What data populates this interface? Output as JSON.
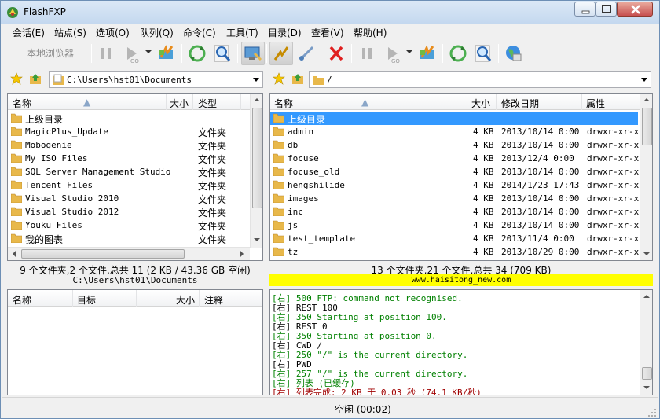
{
  "window": {
    "title": "FlashFXP"
  },
  "menu": [
    "会话(E)",
    "站点(S)",
    "选项(O)",
    "队列(Q)",
    "命令(C)",
    "工具(T)",
    "目录(D)",
    "查看(V)",
    "帮助(H)"
  ],
  "toolbar": {
    "local_browser_label": "本地浏览器"
  },
  "left": {
    "path": "C:\\Users\\hst01\\Documents",
    "columns": [
      "名称",
      "大小",
      "类型"
    ],
    "rows": [
      {
        "name": "上级目录",
        "size": "",
        "type": ""
      },
      {
        "name": "MagicPlus_Update",
        "size": "",
        "type": "文件夹"
      },
      {
        "name": "Mobogenie",
        "size": "",
        "type": "文件夹"
      },
      {
        "name": "My ISO Files",
        "size": "",
        "type": "文件夹"
      },
      {
        "name": "SQL Server Management Studio",
        "size": "",
        "type": "文件夹"
      },
      {
        "name": "Tencent Files",
        "size": "",
        "type": "文件夹"
      },
      {
        "name": "Visual Studio 2010",
        "size": "",
        "type": "文件夹"
      },
      {
        "name": "Visual Studio 2012",
        "size": "",
        "type": "文件夹"
      },
      {
        "name": "Youku Files",
        "size": "",
        "type": "文件夹"
      },
      {
        "name": "我的图表",
        "size": "",
        "type": "文件夹"
      }
    ],
    "status_summary": "9 个文件夹,2 个文件,总共 11 (2 KB / 43.36 GB 空闲)",
    "status_path": "C:\\Users\\hst01\\Documents"
  },
  "right": {
    "path": "/",
    "columns": [
      "名称",
      "大小",
      "修改日期",
      "属性"
    ],
    "rows": [
      {
        "name": "上级目录",
        "size": "",
        "date": "",
        "attr": ""
      },
      {
        "name": "admin",
        "size": "4 KB",
        "date": "2013/10/14 0:00",
        "attr": "drwxr-xr-x"
      },
      {
        "name": "db",
        "size": "4 KB",
        "date": "2013/10/14 0:00",
        "attr": "drwxr-xr-x"
      },
      {
        "name": "focuse",
        "size": "4 KB",
        "date": "2013/12/4 0:00",
        "attr": "drwxr-xr-x"
      },
      {
        "name": "focuse_old",
        "size": "4 KB",
        "date": "2013/10/14 0:00",
        "attr": "drwxr-xr-x"
      },
      {
        "name": "hengshilide",
        "size": "4 KB",
        "date": "2014/1/23 17:43",
        "attr": "drwxr-xr-x"
      },
      {
        "name": "images",
        "size": "4 KB",
        "date": "2013/10/14 0:00",
        "attr": "drwxr-xr-x"
      },
      {
        "name": "inc",
        "size": "4 KB",
        "date": "2013/10/14 0:00",
        "attr": "drwxr-xr-x"
      },
      {
        "name": "js",
        "size": "4 KB",
        "date": "2013/10/14 0:00",
        "attr": "drwxr-xr-x"
      },
      {
        "name": "test_template",
        "size": "4 KB",
        "date": "2013/11/4 0:00",
        "attr": "drwxr-xr-x"
      },
      {
        "name": "tz",
        "size": "4 KB",
        "date": "2013/10/29 0:00",
        "attr": "drwxr-xr-x"
      }
    ],
    "status_summary": "13 个文件夹,21 个文件,总共 34 (709 KB)",
    "status_host": "www.haisitong_new.com"
  },
  "queue": {
    "columns": [
      "名称",
      "目标",
      "大小",
      "注释"
    ]
  },
  "log": [
    {
      "text": "[右] 500 FTP: command not recognised.",
      "color": "#008000"
    },
    {
      "text": "[右] REST 100",
      "color": "#000000"
    },
    {
      "text": "[右] 350 Starting at position 100.",
      "color": "#008000"
    },
    {
      "text": "[右] REST 0",
      "color": "#000000"
    },
    {
      "text": "[右] 350 Starting at position 0.",
      "color": "#008000"
    },
    {
      "text": "[右] CWD /",
      "color": "#000000"
    },
    {
      "text": "[右] 250 \"/\" is the current directory.",
      "color": "#008000"
    },
    {
      "text": "[右] PWD",
      "color": "#000000"
    },
    {
      "text": "[右] 257 \"/\" is the current directory.",
      "color": "#008000"
    },
    {
      "text": "[右] 列表 (已缓存)",
      "color": "#008000"
    },
    {
      "text": "[右] 列表完成: 2 KB 于 0.03 秒 (74.1 KB/秒)",
      "color": "#a00000"
    }
  ],
  "statusbar": {
    "state": "空闲 (00:02)"
  },
  "colors": {
    "selection": "#3399ff",
    "host_bar": "#ffff00",
    "folder": "#e8b84a"
  }
}
